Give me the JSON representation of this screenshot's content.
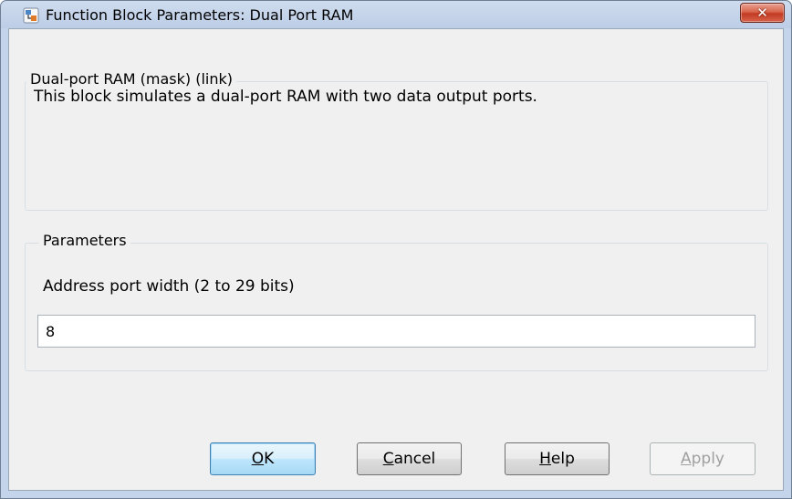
{
  "window": {
    "title": "Function Block Parameters: Dual Port RAM",
    "icon": "simulink-block-icon",
    "close_label": "✕"
  },
  "description_group": {
    "label": "Dual-port RAM (mask) (link)",
    "text": "This block simulates a dual-port RAM with two data output ports."
  },
  "parameters_group": {
    "label": "Parameters",
    "address_width": {
      "label": "Address port width (2 to 29 bits)",
      "value": "8"
    }
  },
  "buttons": {
    "ok": {
      "mnemonic": "O",
      "rest": "K"
    },
    "cancel": {
      "mnemonic": "C",
      "rest": "ancel"
    },
    "help": {
      "mnemonic": "H",
      "rest": "elp"
    },
    "apply": {
      "mnemonic": "A",
      "rest": "pply",
      "enabled": false
    }
  },
  "colors": {
    "title_bar": "#c4d4ea",
    "client_bg": "#f0f0f0",
    "close_button": "#c8442c",
    "default_button_border": "#3c7fb1"
  }
}
